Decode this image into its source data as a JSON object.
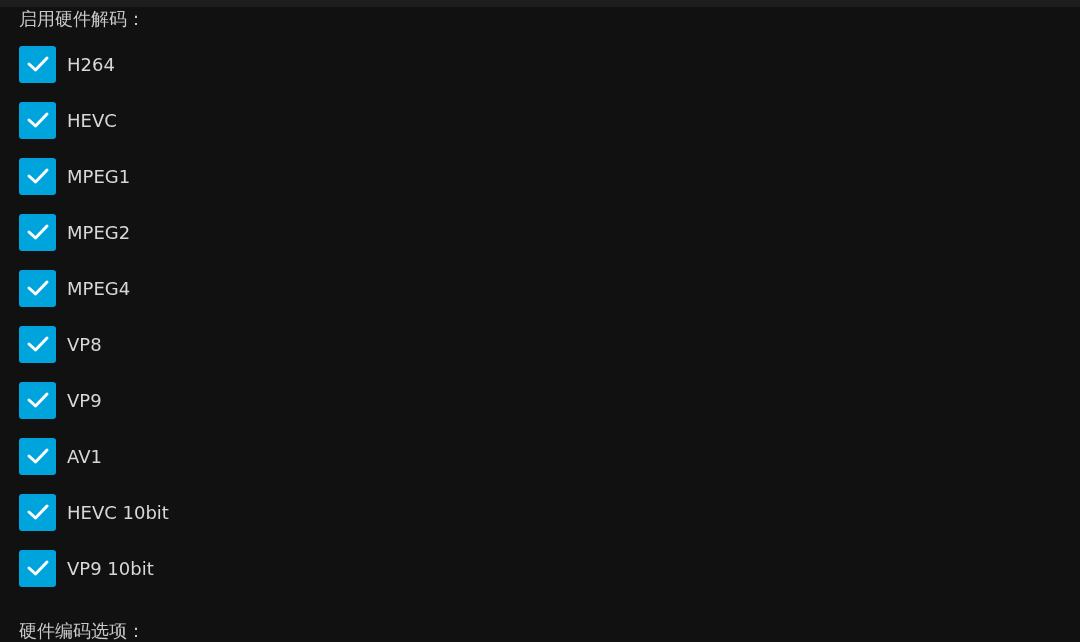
{
  "decoding": {
    "heading": "启用硬件解码：",
    "codecs": [
      {
        "label": "H264",
        "checked": true
      },
      {
        "label": "HEVC",
        "checked": true
      },
      {
        "label": "MPEG1",
        "checked": true
      },
      {
        "label": "MPEG2",
        "checked": true
      },
      {
        "label": "MPEG4",
        "checked": true
      },
      {
        "label": "VP8",
        "checked": true
      },
      {
        "label": "VP9",
        "checked": true
      },
      {
        "label": "AV1",
        "checked": true
      },
      {
        "label": "HEVC 10bit",
        "checked": true
      },
      {
        "label": "VP9 10bit",
        "checked": true
      }
    ]
  },
  "encoding": {
    "heading": "硬件编码选项："
  }
}
